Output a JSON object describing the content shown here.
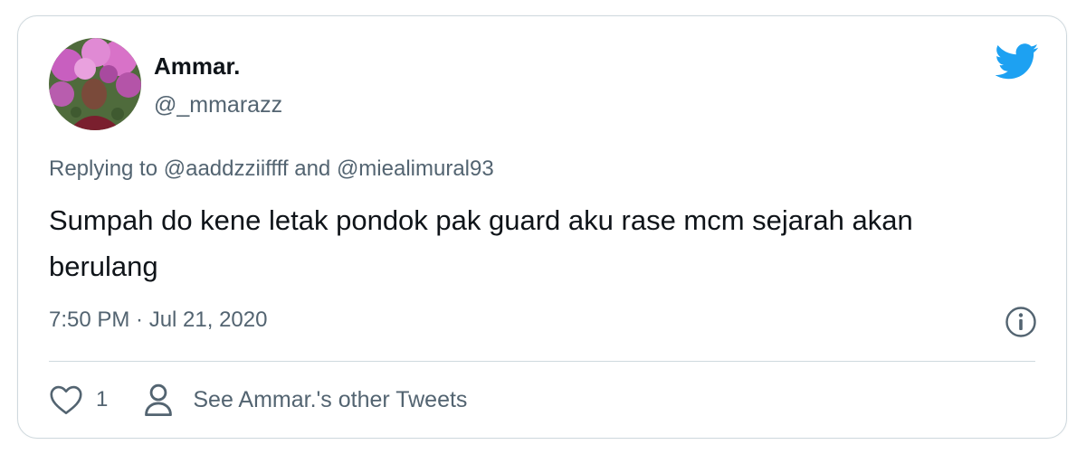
{
  "author": {
    "display_name": "Ammar.",
    "handle": "@_mmarazz"
  },
  "brand": {
    "icon": "twitter-bird-icon",
    "color": "#1da1f2"
  },
  "reply": {
    "prefix": "Replying to",
    "mention_1": "@aaddzziiffff",
    "conjunction": "and",
    "mention_2": "@miealimural93"
  },
  "tweet": {
    "text": "Sumpah do kene letak pondok pak guard aku rase mcm sejarah akan berulang",
    "timestamp": "7:50 PM · Jul 21, 2020"
  },
  "actions": {
    "like_icon": "heart-icon",
    "like_count": "1",
    "profile_icon": "person-icon",
    "other_tweets_label": "See Ammar.'s other Tweets",
    "info_icon": "info-icon"
  }
}
